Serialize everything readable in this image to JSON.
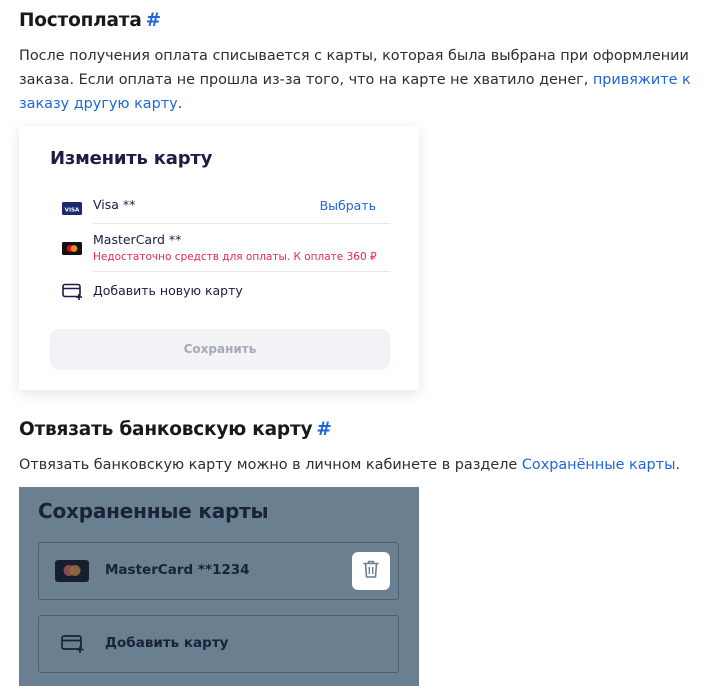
{
  "section_postpay": {
    "heading": "Постоплата",
    "hash": "#",
    "para_before": "После получения оплата списывается с карты, которая была выбрана при оформлении заказа. Если оплата не прошла из-за того, что на карте не хватило денег, ",
    "link": "привяжите к заказу другую карту",
    "para_after": "."
  },
  "change_card_modal": {
    "title": "Изменить карту",
    "visa_label": "Visa **",
    "visa_action": "Выбрать",
    "mastercard_label": "MasterCard **",
    "mastercard_error": "Недостаточно средств для оплаты. К оплате 360 ₽",
    "add_new_card": "Добавить новую карту",
    "save_button": "Сохранить",
    "visa_badge": "VISA"
  },
  "section_unlink": {
    "heading": "Отвязать банковскую карту",
    "hash": "#",
    "para_before": "Отвязать банковскую карту можно в личном кабинете в разделе ",
    "link": "Сохранённые карты",
    "para_after": "."
  },
  "saved_cards_screen": {
    "title": "Сохраненные карты",
    "card_label": "MasterCard **1234",
    "add_card": "Добавить карту"
  },
  "icons": {
    "visa": "visa-logo-icon",
    "mastercard": "mastercard-logo-icon",
    "add_card": "add-card-icon",
    "trash": "trash-icon"
  },
  "colors": {
    "link": "#1f66db",
    "error": "#e6265a",
    "overlay": "#6a7f8f"
  }
}
